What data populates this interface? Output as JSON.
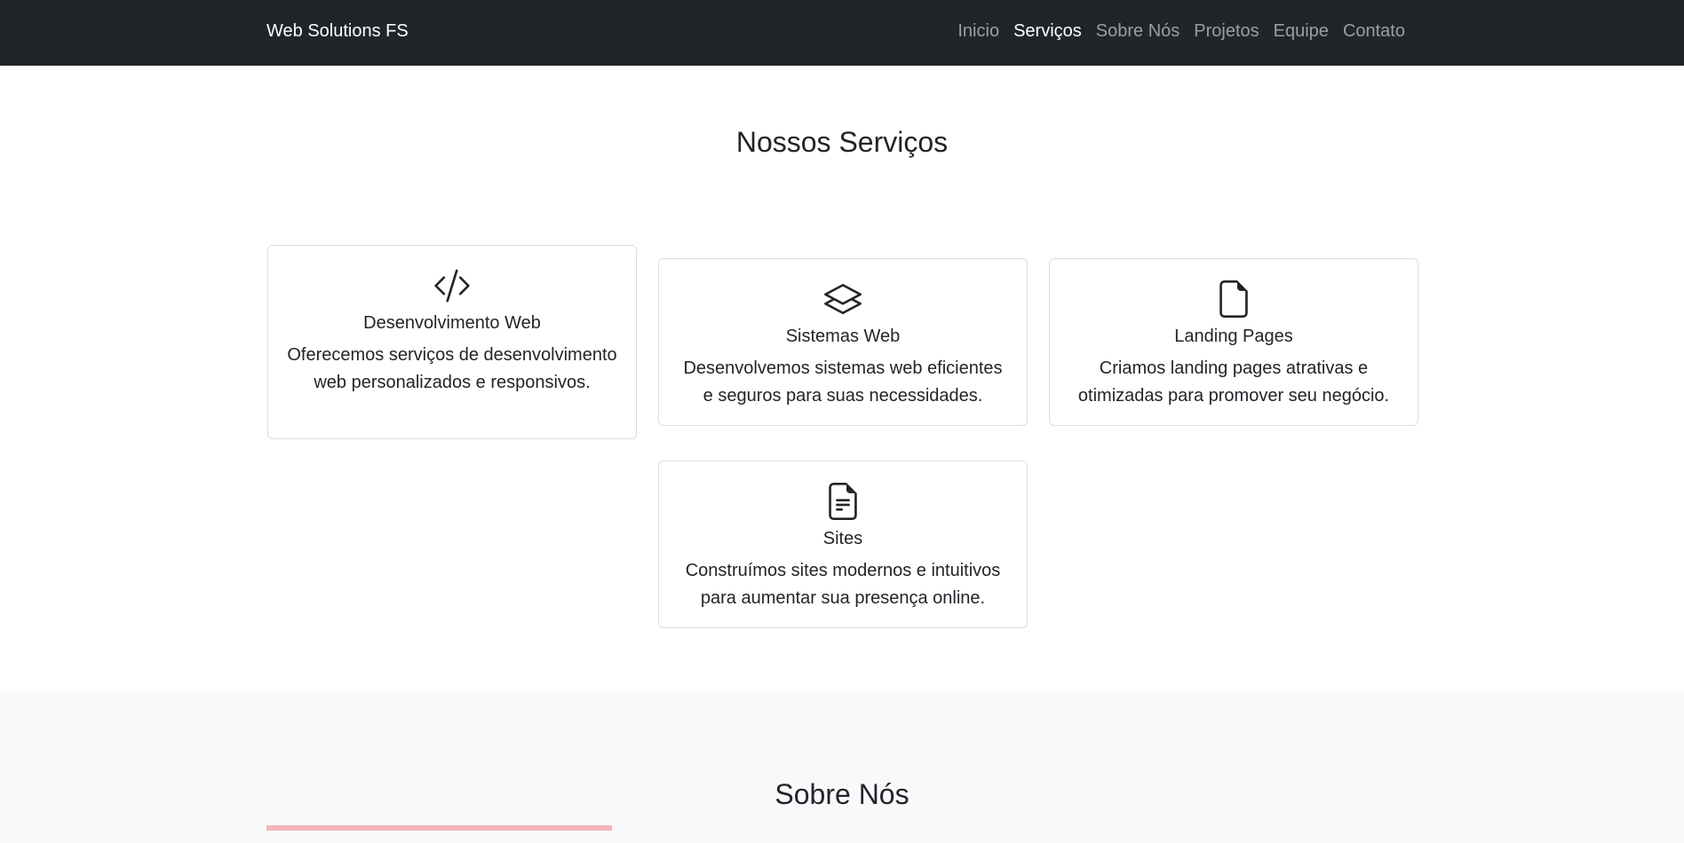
{
  "navbar": {
    "brand": "Web Solutions FS",
    "links": [
      {
        "label": "Inicio",
        "active": false
      },
      {
        "label": "Serviços",
        "active": true
      },
      {
        "label": "Sobre Nós",
        "active": false
      },
      {
        "label": "Projetos",
        "active": false
      },
      {
        "label": "Equipe",
        "active": false
      },
      {
        "label": "Contato",
        "active": false
      }
    ]
  },
  "services": {
    "title": "Nossos Serviços",
    "cards": [
      {
        "icon": "code-icon",
        "title": "Desenvolvimento Web",
        "text": "Oferecemos serviços de desenvolvimento web personalizados e responsivos."
      },
      {
        "icon": "layers-icon",
        "title": "Sistemas Web",
        "text": "Desenvolvemos sistemas web eficientes e seguros para suas necessidades."
      },
      {
        "icon": "file-icon",
        "title": "Landing Pages",
        "text": "Criamos landing pages atrativas e otimizadas para promover seu negócio."
      },
      {
        "icon": "file-text-icon",
        "title": "Sites",
        "text": "Construímos sites modernos e intuitivos para aumentar sua presença online."
      }
    ]
  },
  "about": {
    "title": "Sobre Nós",
    "accent_color": "#f5b5b8"
  },
  "colors": {
    "navbar_bg": "#212529",
    "nav_active": "#ffffff",
    "nav_inactive": "rgba(255,255,255,0.55)",
    "about_bg": "#f8f9fa"
  }
}
